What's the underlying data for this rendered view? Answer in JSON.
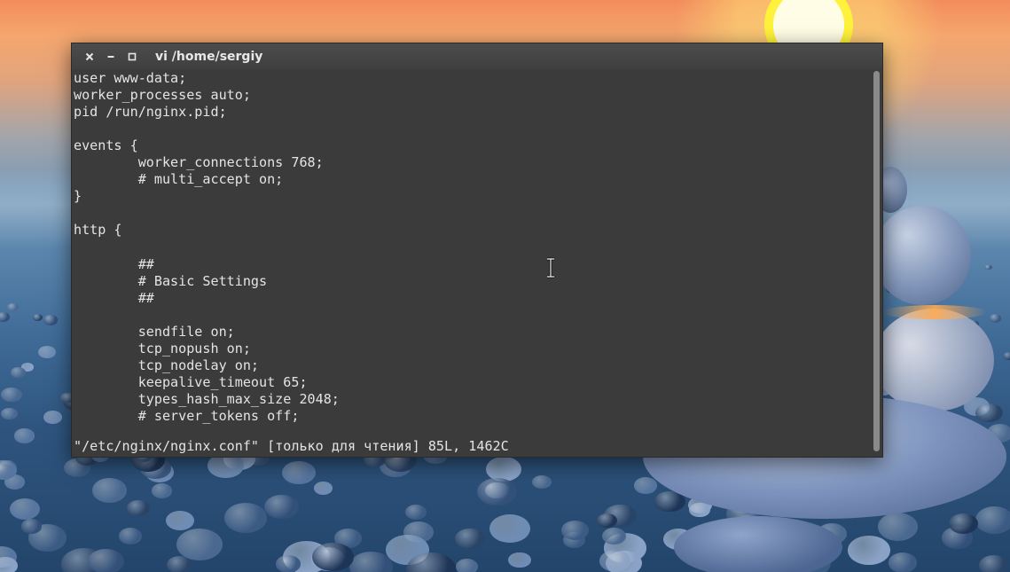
{
  "window": {
    "title": "vi /home/sergiy",
    "controls": [
      "close-icon",
      "minimize-icon",
      "maximize-icon"
    ]
  },
  "editor": {
    "lines": [
      "user www-data;",
      "worker_processes auto;",
      "pid /run/nginx.pid;",
      "",
      "events {",
      "        worker_connections 768;",
      "        # multi_accept on;",
      "}",
      "",
      "http {",
      "",
      "        ##",
      "        # Basic Settings",
      "        ##",
      "",
      "        sendfile on;",
      "        tcp_nopush on;",
      "        tcp_nodelay on;",
      "        keepalive_timeout 65;",
      "        types_hash_max_size 2048;",
      "        # server_tokens off;"
    ],
    "status_line": "\"/etc/nginx/nginx.conf\" [только для чтения] 85L, 1462C"
  },
  "cursor": "ibeam-cursor-icon",
  "colors": {
    "terminal_bg": "#3b3b3b",
    "text": "#e4e4e4",
    "titlebar": "#454545"
  }
}
